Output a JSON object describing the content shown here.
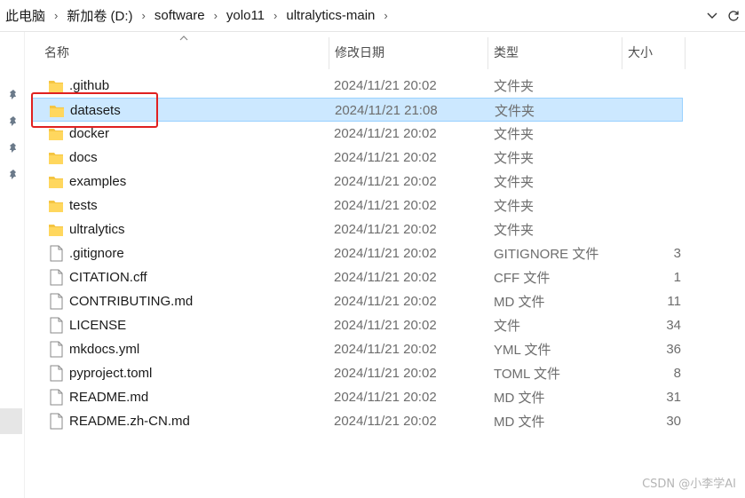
{
  "breadcrumbs": [
    "此电脑",
    "新加卷 (D:)",
    "software",
    "yolo11",
    "ultralytics-main"
  ],
  "columns": {
    "name": "名称",
    "date": "修改日期",
    "type": "类型",
    "size": "大小"
  },
  "files": [
    {
      "name": ".github",
      "date": "2024/11/21 20:02",
      "type": "文件夹",
      "size": "",
      "icon": "folder-icon"
    },
    {
      "name": "datasets",
      "date": "2024/11/21 21:08",
      "type": "文件夹",
      "size": "",
      "icon": "folder-icon",
      "selected": true
    },
    {
      "name": "docker",
      "date": "2024/11/21 20:02",
      "type": "文件夹",
      "size": "",
      "icon": "folder-icon"
    },
    {
      "name": "docs",
      "date": "2024/11/21 20:02",
      "type": "文件夹",
      "size": "",
      "icon": "folder-icon"
    },
    {
      "name": "examples",
      "date": "2024/11/21 20:02",
      "type": "文件夹",
      "size": "",
      "icon": "folder-icon"
    },
    {
      "name": "tests",
      "date": "2024/11/21 20:02",
      "type": "文件夹",
      "size": "",
      "icon": "folder-icon"
    },
    {
      "name": "ultralytics",
      "date": "2024/11/21 20:02",
      "type": "文件夹",
      "size": "",
      "icon": "folder-icon"
    },
    {
      "name": ".gitignore",
      "date": "2024/11/21 20:02",
      "type": "GITIGNORE 文件",
      "size": "3",
      "icon": "file-icon"
    },
    {
      "name": "CITATION.cff",
      "date": "2024/11/21 20:02",
      "type": "CFF 文件",
      "size": "1",
      "icon": "file-icon"
    },
    {
      "name": "CONTRIBUTING.md",
      "date": "2024/11/21 20:02",
      "type": "MD 文件",
      "size": "11",
      "icon": "file-icon"
    },
    {
      "name": "LICENSE",
      "date": "2024/11/21 20:02",
      "type": "文件",
      "size": "34",
      "icon": "file-icon"
    },
    {
      "name": "mkdocs.yml",
      "date": "2024/11/21 20:02",
      "type": "YML 文件",
      "size": "36",
      "icon": "file-icon"
    },
    {
      "name": "pyproject.toml",
      "date": "2024/11/21 20:02",
      "type": "TOML 文件",
      "size": "8",
      "icon": "file-icon"
    },
    {
      "name": "README.md",
      "date": "2024/11/21 20:02",
      "type": "MD 文件",
      "size": "31",
      "icon": "file-icon"
    },
    {
      "name": "README.zh-CN.md",
      "date": "2024/11/21 20:02",
      "type": "MD 文件",
      "size": "30",
      "icon": "file-icon"
    }
  ],
  "watermark": "CSDN @小李学AI",
  "colors": {
    "selection": "#cce8ff",
    "selection_border": "#99d1ff",
    "highlight_box": "#e02020",
    "folder": "#f5c542"
  }
}
